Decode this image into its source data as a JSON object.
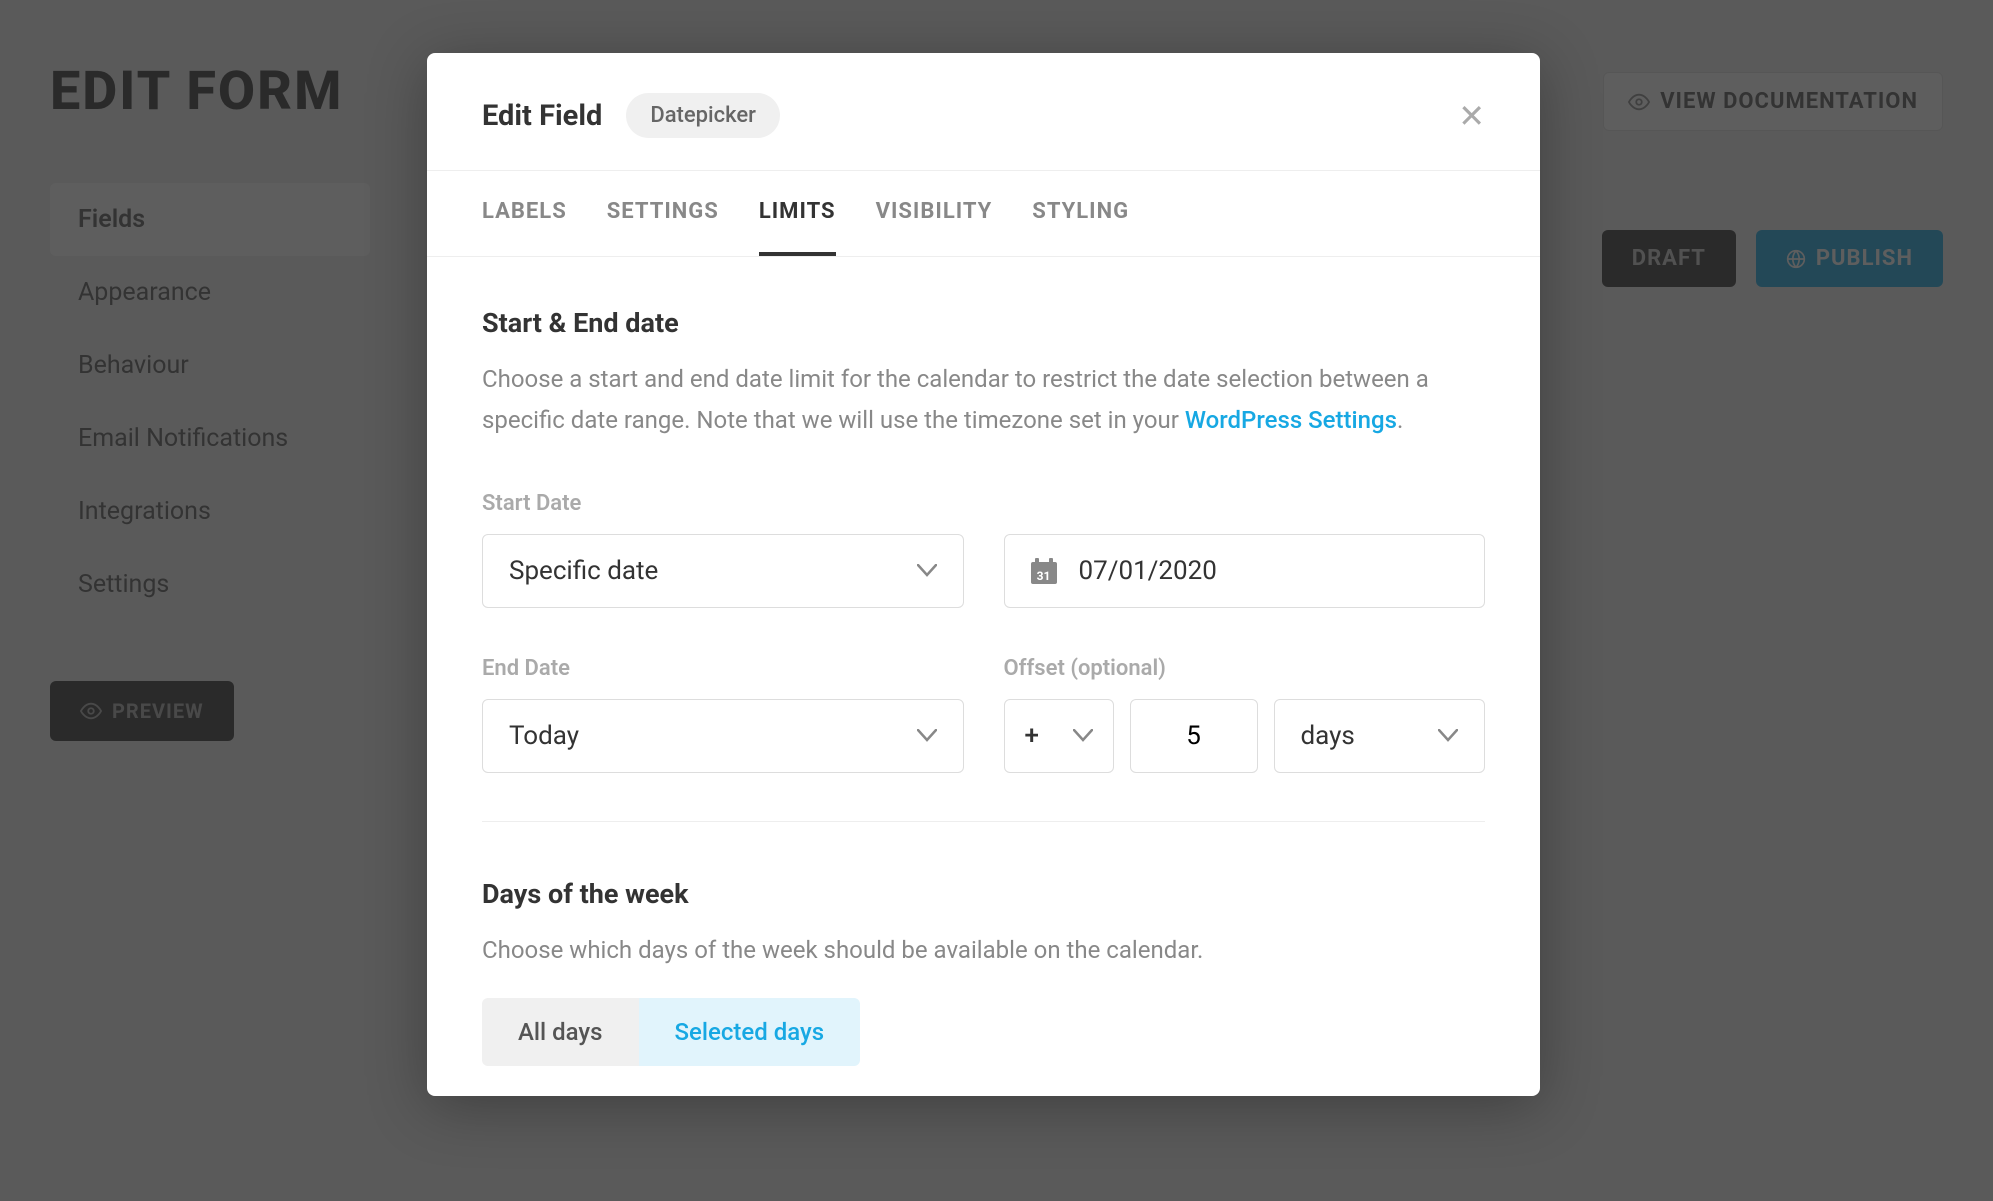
{
  "page": {
    "title": "EDIT FORM",
    "nav": [
      "Fields",
      "Appearance",
      "Behaviour",
      "Email Notifications",
      "Integrations",
      "Settings"
    ],
    "preview": "PREVIEW",
    "docs": "VIEW DOCUMENTATION",
    "draft": "DRAFT",
    "publish": "PUBLISH"
  },
  "modal": {
    "title": "Edit Field",
    "chip": "Datepicker",
    "tabs": [
      "LABELS",
      "SETTINGS",
      "LIMITS",
      "VISIBILITY",
      "STYLING"
    ],
    "activeTab": 2,
    "section1": {
      "title": "Start & End date",
      "desc_a": "Choose a start and end date limit for the calendar to restrict the date selection between a specific date range. Note that we will use the timezone set in your ",
      "desc_link": "WordPress Settings",
      "desc_b": "."
    },
    "start": {
      "label": "Start Date",
      "type": "Specific date",
      "value": "07/01/2020"
    },
    "end": {
      "label": "End Date",
      "type": "Today",
      "offset_label": "Offset (optional)",
      "sign": "+",
      "num": "5",
      "unit": "days"
    },
    "section2": {
      "title": "Days of the week",
      "desc": "Choose which days of the week should be available on the calendar.",
      "opt_a": "All days",
      "opt_b": "Selected days"
    }
  }
}
